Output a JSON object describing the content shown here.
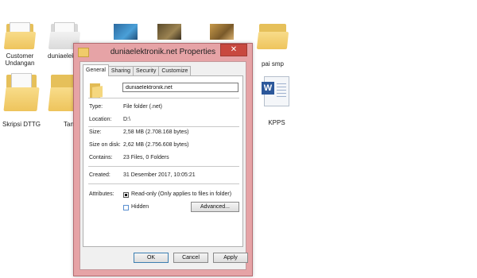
{
  "desktop": {
    "icons": [
      {
        "label": "Customer Undangan",
        "icon": "folder-icon"
      },
      {
        "label": "duniaelek et",
        "icon": "folder-icon"
      },
      {
        "label": "",
        "icon": "image-icon"
      },
      {
        "label": "",
        "icon": "image-icon"
      },
      {
        "label": "",
        "icon": "image-icon"
      },
      {
        "label": "pai smp",
        "icon": "folder-icon"
      },
      {
        "label": "Skripsi DTTG",
        "icon": "folder-icon"
      },
      {
        "label": "Tan",
        "icon": "folder-icon"
      },
      {
        "label": "KPPS",
        "icon": "word-document-icon"
      }
    ]
  },
  "dialog": {
    "title": "duniaelektronik.net Properties",
    "close_label": "✕",
    "tabs": [
      {
        "label": "General",
        "active": true
      },
      {
        "label": "Sharing",
        "active": false
      },
      {
        "label": "Security",
        "active": false
      },
      {
        "label": "Customize",
        "active": false
      }
    ],
    "folder_name": "duniaelektronik.net",
    "properties": {
      "type_label": "Type:",
      "type_value": "File folder (.net)",
      "location_label": "Location:",
      "location_value": "D:\\",
      "size_label": "Size:",
      "size_value": "2,58 MB (2.708.168 bytes)",
      "size_on_disk_label": "Size on disk:",
      "size_on_disk_value": "2,62 MB (2.756.608 bytes)",
      "contains_label": "Contains:",
      "contains_value": "23 Files, 0 Folders",
      "created_label": "Created:",
      "created_value": "31 Desember 2017, 10:05:21",
      "attributes_label": "Attributes:",
      "readonly_label": "Read-only (Only applies to files in folder)",
      "readonly_checked": true,
      "hidden_label": "Hidden",
      "hidden_checked": false,
      "advanced_label": "Advanced..."
    },
    "buttons": {
      "ok": "OK",
      "cancel": "Cancel",
      "apply": "Apply"
    },
    "colors": {
      "frame": "#e6a3a6",
      "close": "#c8483f",
      "folder": "#f0cb6a"
    }
  }
}
